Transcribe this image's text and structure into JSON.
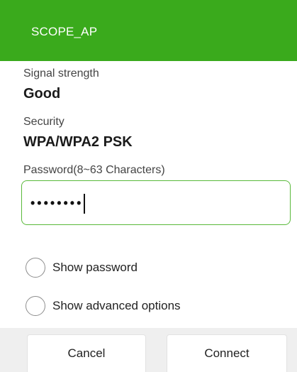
{
  "dialog": {
    "title": "SCOPE_AP",
    "signal": {
      "label": "Signal strength",
      "value": "Good"
    },
    "security": {
      "label": "Security",
      "value": "WPA/WPA2 PSK"
    },
    "password": {
      "label": "Password(8~63 Characters)",
      "masked_value": "••••••••"
    },
    "options": [
      {
        "label": "Show password",
        "checked": false
      },
      {
        "label": "Show advanced options",
        "checked": false
      }
    ],
    "buttons": {
      "cancel": "Cancel",
      "connect": "Connect"
    }
  },
  "colors": {
    "accent": "#3aaa1c",
    "input_border": "#59b93a",
    "button_bar": "#efefef"
  }
}
